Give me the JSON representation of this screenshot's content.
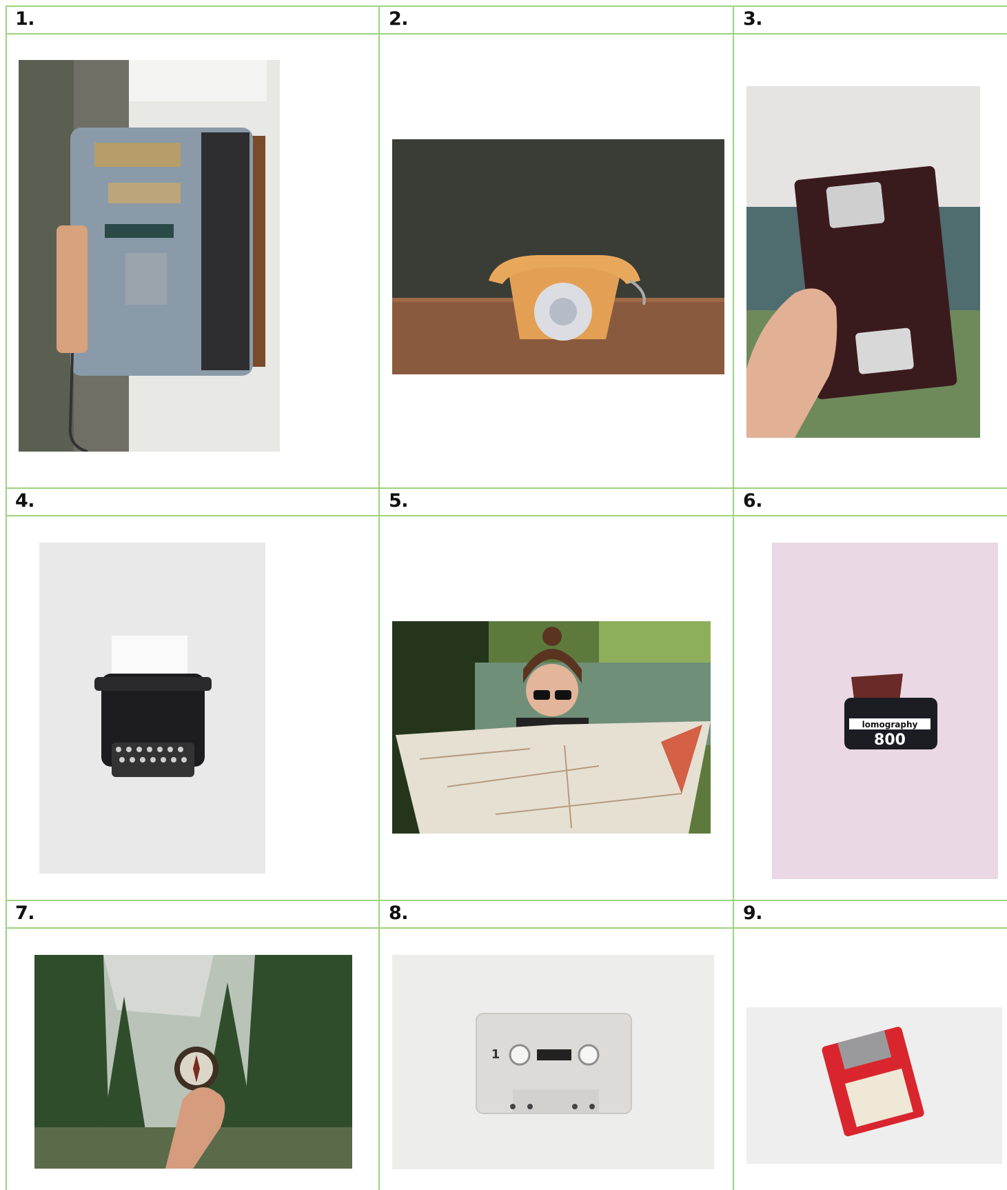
{
  "cells": [
    {
      "label": "1.",
      "subject": "wall-mounted payphone"
    },
    {
      "label": "2.",
      "subject": "orange rotary telephone"
    },
    {
      "label": "3.",
      "subject": "hand holding VHS cassette"
    },
    {
      "label": "4.",
      "subject": "black typewriter"
    },
    {
      "label": "5.",
      "subject": "woman reading paper map"
    },
    {
      "label": "6.",
      "subject": "film canister",
      "brand_text": "lomography",
      "film_speed": "800"
    },
    {
      "label": "7.",
      "subject": "hand holding compass in forest"
    },
    {
      "label": "8.",
      "subject": "white audio cassette",
      "tape_side": "1"
    },
    {
      "label": "9.",
      "subject": "red floppy disk"
    }
  ],
  "colors": {
    "grid_line": "#9bd27f",
    "label_text": "#111111"
  }
}
